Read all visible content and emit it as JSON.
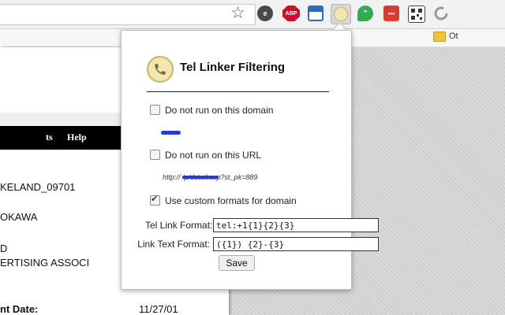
{
  "toolbar": {
    "bookmark_folder": "Ot",
    "extensions": [
      {
        "name": "evernote",
        "label": "e",
        "color": "#4a4a4a"
      },
      {
        "name": "adblock",
        "label": "ABP",
        "color": "#c8102e"
      },
      {
        "name": "window",
        "label": "",
        "color": "#2a6db5"
      },
      {
        "name": "tel-linker",
        "label": "",
        "color": "#d8d8d8"
      },
      {
        "name": "hangouts",
        "label": "",
        "color": "#34a853"
      },
      {
        "name": "dots",
        "label": "•••",
        "color": "#d23f31"
      },
      {
        "name": "qr",
        "label": "",
        "color": "#444444"
      },
      {
        "name": "refresh",
        "label": "",
        "color": "#aaaaaa"
      }
    ]
  },
  "page": {
    "nav_item_partial": "ts",
    "nav_item": "Help",
    "line1": "KELAND_09701",
    "line2": "OKAWA",
    "line3": "D",
    "line4": "ERTISING ASSOCI",
    "date_label": "nt Date:",
    "date_value": "11/27/01"
  },
  "popup": {
    "title": "Tel Linker Filtering",
    "domain_checkbox": {
      "label": "Do not run on this domain",
      "checked": false
    },
    "url_checkbox": {
      "label": "Do not run on this URL",
      "checked": false
    },
    "url_value": "http://                    /p/detail.asp?st_pk=889",
    "custom_checkbox": {
      "label": "Use custom formats for domain",
      "checked": true
    },
    "tel_link_label": "Tel Link Format:",
    "tel_link_value": "tel:+1{1}{2}{3}",
    "link_text_label": "Link Text Format:",
    "link_text_value": "({1}) {2}-{3}",
    "save_label": "Save"
  }
}
